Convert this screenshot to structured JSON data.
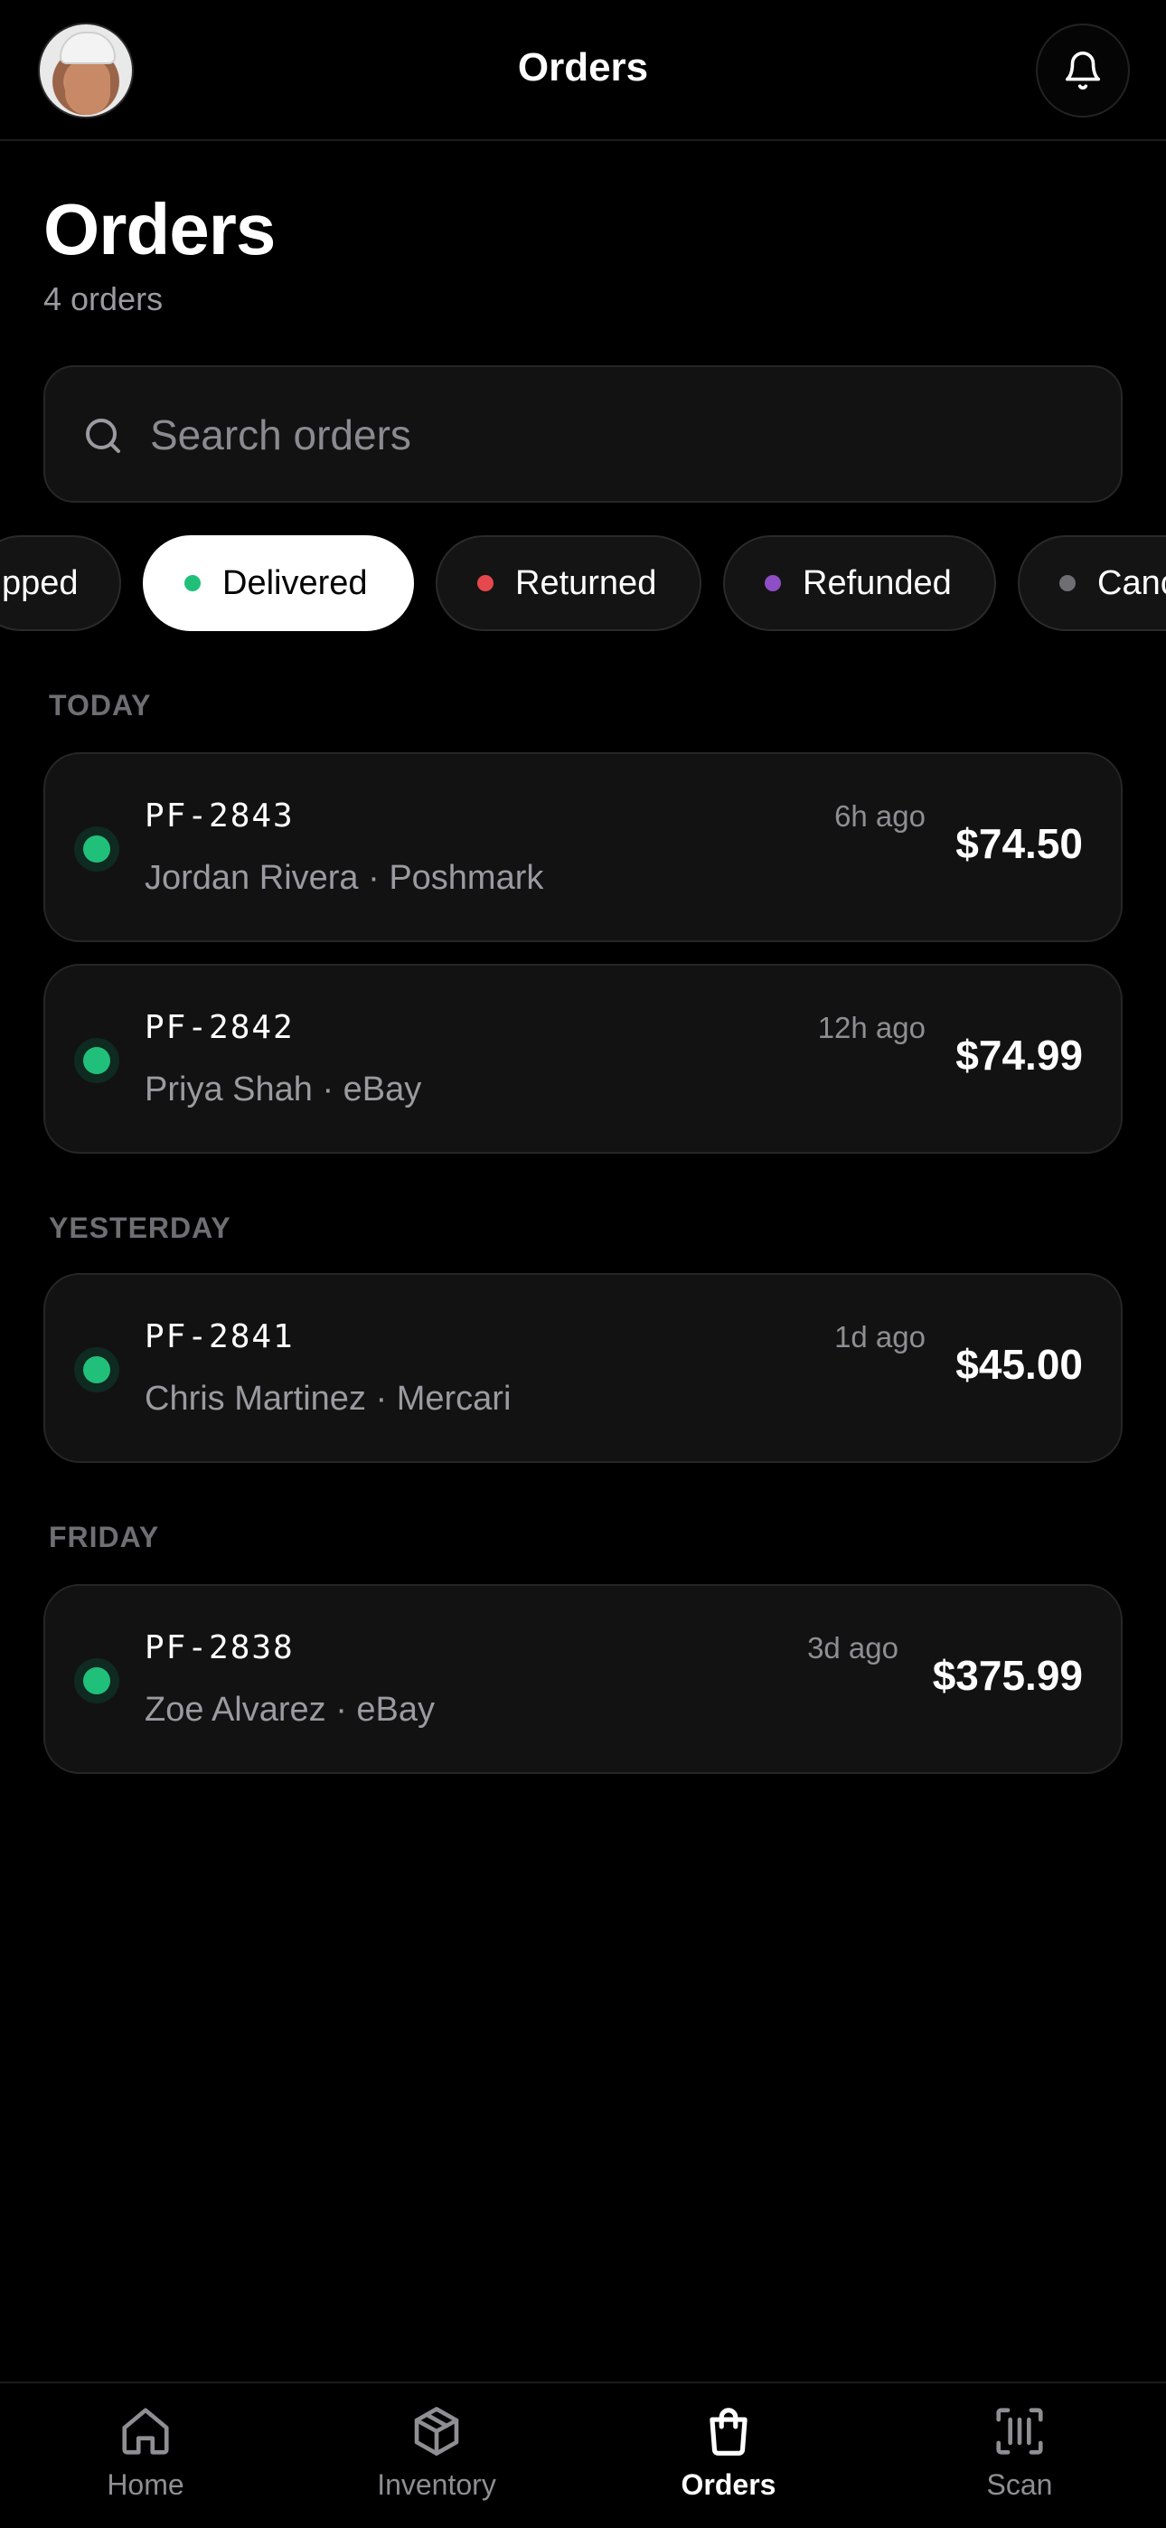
{
  "header": {
    "title": "Orders",
    "avatar_icon": "user-avatar",
    "bell_icon": "bell-icon"
  },
  "page": {
    "title": "Orders",
    "count": "4 orders"
  },
  "search": {
    "placeholder": "Search orders",
    "value": ""
  },
  "filters": [
    {
      "label": "Shipped",
      "display": "pped",
      "dot": null,
      "active": false
    },
    {
      "label": "Delivered",
      "dot": "#21c07a",
      "active": true
    },
    {
      "label": "Returned",
      "dot": "#e5484d",
      "active": false
    },
    {
      "label": "Refunded",
      "dot": "#8e4ec6",
      "active": false
    },
    {
      "label": "Cancelled",
      "display": "Canc",
      "dot": "#6e6e73",
      "active": false
    }
  ],
  "groups": [
    {
      "label": "TODAY",
      "orders": [
        {
          "id": "PF-2843",
          "customer": "Jordan Rivera",
          "marketplace": "Poshmark",
          "meta": "Jordan Rivera · Poshmark",
          "time": "6h ago",
          "price": "$74.50",
          "status": "delivered"
        },
        {
          "id": "PF-2842",
          "customer": "Priya Shah",
          "marketplace": "eBay",
          "meta": "Priya Shah · eBay",
          "time": "12h ago",
          "price": "$74.99",
          "status": "delivered"
        }
      ]
    },
    {
      "label": "YESTERDAY",
      "orders": [
        {
          "id": "PF-2841",
          "customer": "Chris Martinez",
          "marketplace": "Mercari",
          "meta": "Chris Martinez · Mercari",
          "time": "1d ago",
          "price": "$45.00",
          "status": "delivered"
        }
      ]
    },
    {
      "label": "FRIDAY",
      "orders": [
        {
          "id": "PF-2838",
          "customer": "Zoe Alvarez",
          "marketplace": "eBay",
          "meta": "Zoe Alvarez · eBay",
          "time": "3d ago",
          "price": "$375.99",
          "status": "delivered"
        }
      ]
    }
  ],
  "nav": [
    {
      "label": "Home",
      "icon": "home-icon",
      "active": false
    },
    {
      "label": "Inventory",
      "icon": "box-icon",
      "active": false
    },
    {
      "label": "Orders",
      "icon": "shopping-bag-icon",
      "active": true
    },
    {
      "label": "Scan",
      "icon": "barcode-scan-icon",
      "active": false
    }
  ],
  "colors": {
    "background": "#000000",
    "card": "#121212",
    "delivered": "#21c07a",
    "returned": "#e5484d",
    "refunded": "#8e4ec6",
    "cancelled": "#6e6e73"
  }
}
